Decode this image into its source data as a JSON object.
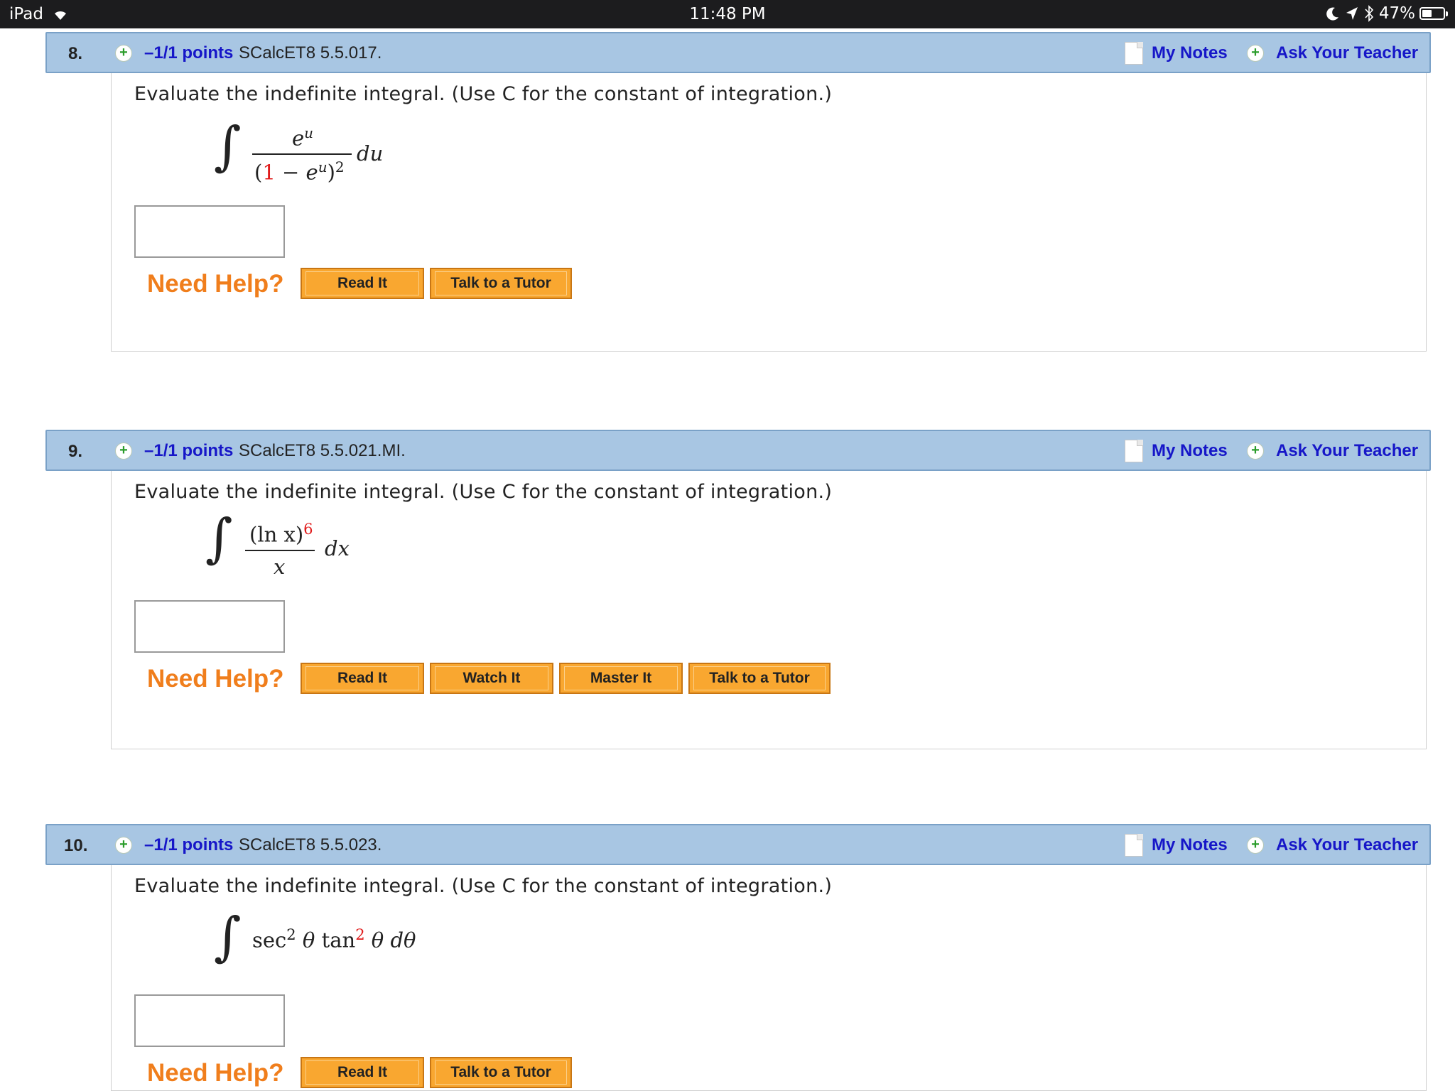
{
  "status_bar": {
    "device": "iPad",
    "time": "11:48 PM",
    "battery": "47%",
    "battery_level": 0.47
  },
  "questions": [
    {
      "number": "8.",
      "points": "–1/1 points",
      "code": "SCalcET8 5.5.017.",
      "my_notes": "My Notes",
      "ask_teacher": "Ask Your Teacher",
      "prompt": "Evaluate the indefinite integral. (Use C for the constant of integration.)",
      "math": {
        "numerator": "e",
        "numerator_sup": "u",
        "denom_open": "(",
        "denom_red": "1",
        "denom_rest": " − e",
        "denom_sup": "u",
        "denom_close": ")",
        "denom_pow": "2",
        "differential": "du"
      },
      "need_help": "Need Help?",
      "buttons": [
        "Read It",
        "Talk to a Tutor"
      ]
    },
    {
      "number": "9.",
      "points": "–1/1 points",
      "code": "SCalcET8 5.5.021.MI.",
      "my_notes": "My Notes",
      "ask_teacher": "Ask Your Teacher",
      "prompt": "Evaluate the indefinite integral. (Use C for the constant of integration.)",
      "math": {
        "numerator": "(ln x)",
        "numerator_pow": "6",
        "denominator": "x",
        "differential": "dx"
      },
      "need_help": "Need Help?",
      "buttons": [
        "Read It",
        "Watch It",
        "Master It",
        "Talk to a Tutor"
      ]
    },
    {
      "number": "10.",
      "points": "–1/1 points",
      "code": "SCalcET8 5.5.023.",
      "my_notes": "My Notes",
      "ask_teacher": "Ask Your Teacher",
      "prompt": "Evaluate the indefinite integral. (Use C for the constant of integration.)",
      "math": {
        "sec": "sec",
        "sec_pow": "2",
        "theta1": "θ",
        "tan": "tan",
        "tan_pow": "2",
        "theta2": "θ",
        "differential": "dθ"
      },
      "need_help": "Need Help?",
      "buttons": [
        "Read It",
        "Talk to a Tutor"
      ]
    }
  ],
  "icons": {
    "expand": "plus-circle-icon",
    "notes": "note-page-icon",
    "wifi": "wifi-icon",
    "moon": "moon-icon",
    "location": "location-arrow-icon",
    "bluetooth": "bluetooth-icon",
    "battery": "battery-icon"
  },
  "colors": {
    "header_bg": "#a8c6e3",
    "link": "#1616c8",
    "need_help": "#f07e1c",
    "button": "#f9a730",
    "red_value": "#e01a1a"
  }
}
